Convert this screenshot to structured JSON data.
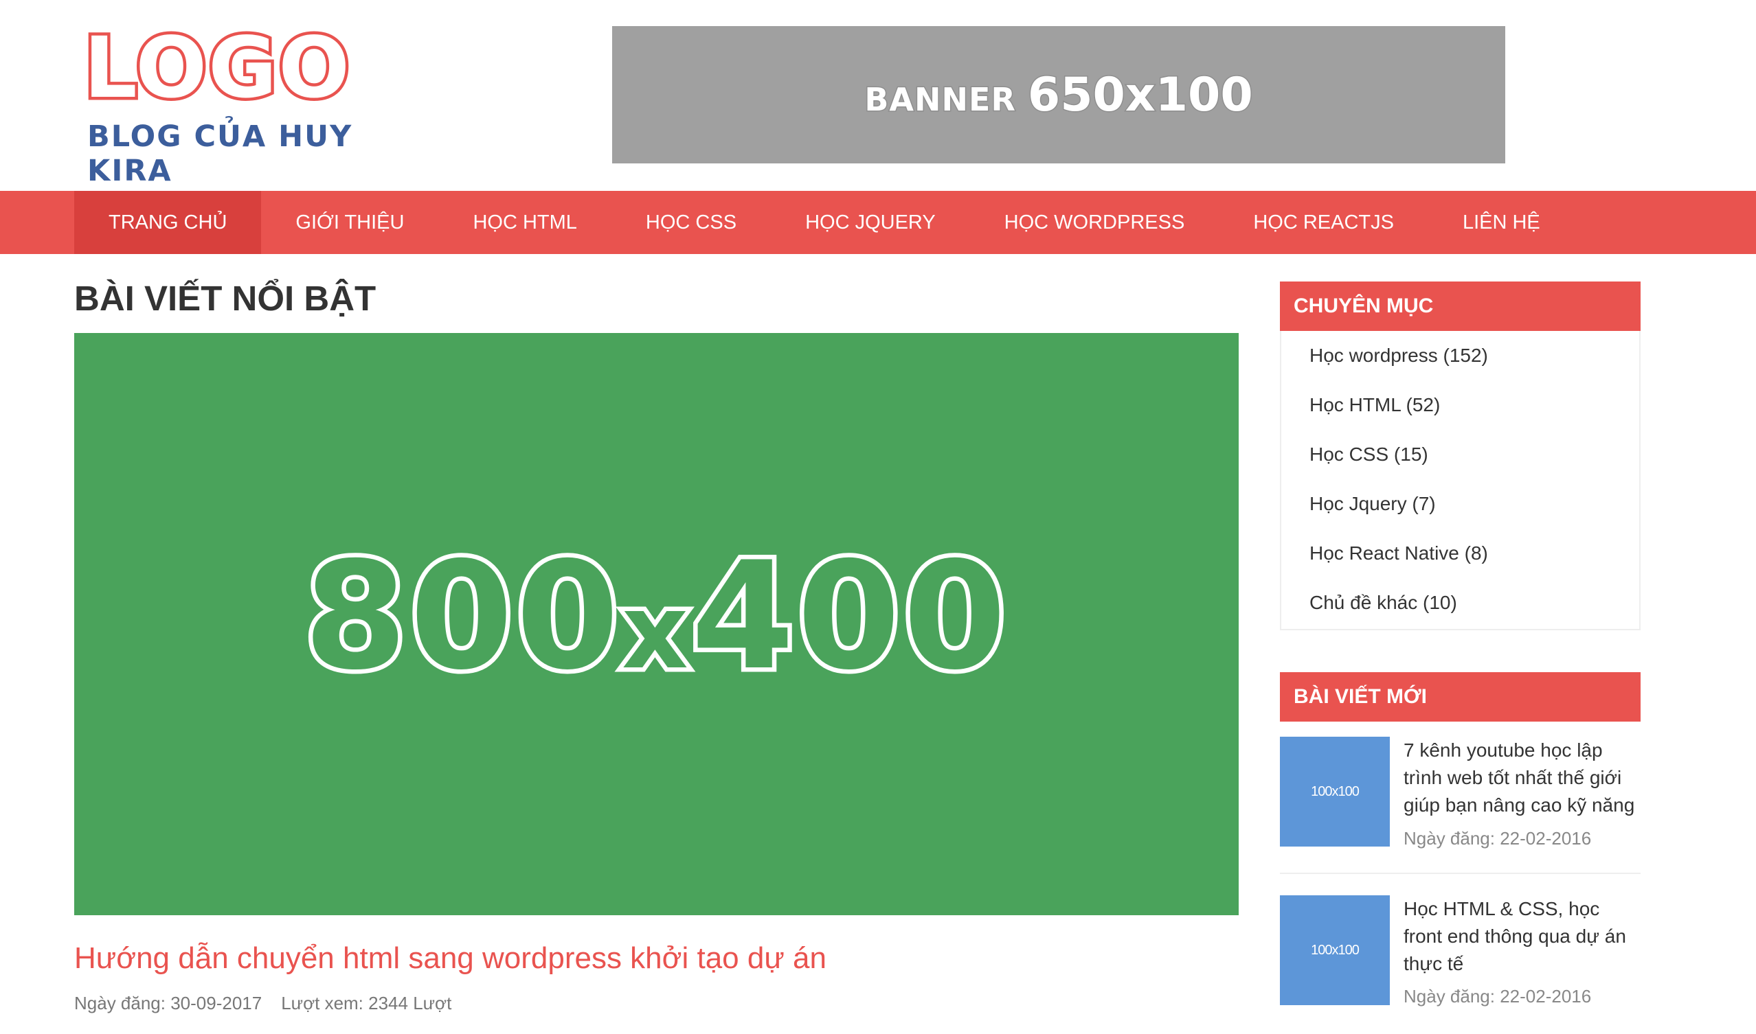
{
  "header": {
    "logo_main": "LOGO",
    "logo_sub": "BLOG CỦA HUY KIRA",
    "banner_label": "BANNER",
    "banner_size": "650x100"
  },
  "nav": {
    "items": [
      {
        "label": "TRANG CHỦ",
        "active": true
      },
      {
        "label": "GIỚI THIỆU"
      },
      {
        "label": "HỌC HTML"
      },
      {
        "label": "HỌC CSS"
      },
      {
        "label": "HỌC JQUERY"
      },
      {
        "label": "HỌC WORDPRESS"
      },
      {
        "label": "HỌC REACTJS"
      },
      {
        "label": "LIÊN HỆ"
      }
    ]
  },
  "main": {
    "section_title": "BÀI VIẾT NỔI BẬT",
    "featured": {
      "image_w": "800",
      "image_x": "x",
      "image_h": "400",
      "title": "Hướng dẫn chuyển html sang wordpress khởi tạo dự án",
      "date": "Ngày đăng: 30-09-2017",
      "views": "Lượt xem: 2344 Lượt"
    }
  },
  "sidebar": {
    "categories": {
      "title": "CHUYÊN MỤC",
      "items": [
        {
          "label": "Học wordpress (152)"
        },
        {
          "label": "Học HTML (52)"
        },
        {
          "label": "Học CSS (15)"
        },
        {
          "label": "Học Jquery (7)"
        },
        {
          "label": "Học React Native (8)"
        },
        {
          "label": "Chủ đề khác (10)"
        }
      ]
    },
    "recent": {
      "title": "BÀI VIẾT MỚI",
      "items": [
        {
          "thumb": "100x100",
          "title": "7 kênh youtube học lập trình web tốt nhất thế giới giúp bạn nâng cao kỹ năng",
          "date": "Ngày đăng: 22-02-2016"
        },
        {
          "thumb": "100x100",
          "title": "Học HTML & CSS, học front end thông qua dự án thực tế",
          "date": "Ngày đăng: 22-02-2016"
        }
      ]
    }
  },
  "colors": {
    "accent": "#e9534f",
    "accent_active": "#d8403d",
    "logo_sub": "#3c5e9c",
    "banner": "#a0a0a0",
    "featured_image": "#4aa35b",
    "thumb": "#5d96d8"
  }
}
